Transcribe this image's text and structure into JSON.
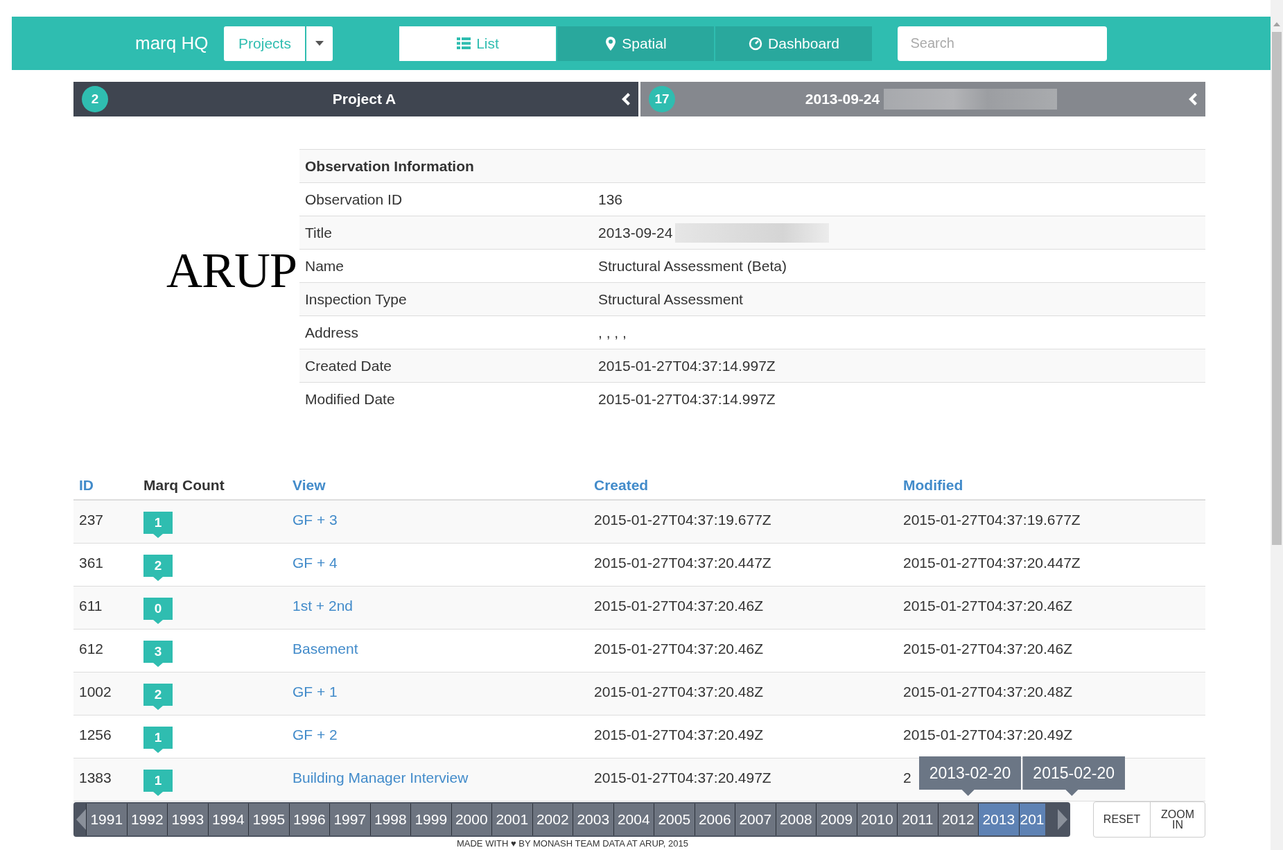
{
  "navbar": {
    "brand": "marq HQ",
    "projects_button": "Projects",
    "tabs": [
      {
        "label": "List",
        "selected": true
      },
      {
        "label": "Spatial",
        "selected": false
      },
      {
        "label": "Dashboard",
        "selected": false
      }
    ],
    "search": {
      "placeholder": "Search"
    }
  },
  "breadcrumb": [
    {
      "count": "2",
      "label": "Project A",
      "kind": "project"
    },
    {
      "count": "17",
      "label": "2013-09-24",
      "kind": "observation"
    }
  ],
  "observation_info": {
    "title": "Observation Information",
    "rows": [
      {
        "label": "Observation ID",
        "value": "136"
      },
      {
        "label": "Title",
        "value": "2013-09-24",
        "redacted": true
      },
      {
        "label": "Name",
        "value": "Structural Assessment (Beta)"
      },
      {
        "label": "Inspection Type",
        "value": "Structural Assessment"
      },
      {
        "label": "Address",
        "value": ", , , ,"
      },
      {
        "label": "Created Date",
        "value": "2015-01-27T04:37:14.997Z"
      },
      {
        "label": "Modified Date",
        "value": "2015-01-27T04:37:14.997Z"
      }
    ]
  },
  "logo": "ARUP",
  "table": {
    "columns": [
      {
        "label": "ID",
        "sortable": true
      },
      {
        "label": "Marq Count",
        "sortable": false
      },
      {
        "label": "View",
        "sortable": true
      },
      {
        "label": "Created",
        "sortable": true
      },
      {
        "label": "Modified",
        "sortable": true
      }
    ],
    "rows": [
      {
        "id": "237",
        "count": "1",
        "view": "GF + 3",
        "created": "2015-01-27T04:37:19.677Z",
        "modified": "2015-01-27T04:37:19.677Z"
      },
      {
        "id": "361",
        "count": "2",
        "view": "GF + 4",
        "created": "2015-01-27T04:37:20.447Z",
        "modified": "2015-01-27T04:37:20.447Z"
      },
      {
        "id": "611",
        "count": "0",
        "view": "1st + 2nd",
        "created": "2015-01-27T04:37:20.46Z",
        "modified": "2015-01-27T04:37:20.46Z"
      },
      {
        "id": "612",
        "count": "3",
        "view": "Basement",
        "created": "2015-01-27T04:37:20.46Z",
        "modified": "2015-01-27T04:37:20.46Z"
      },
      {
        "id": "1002",
        "count": "2",
        "view": "GF + 1",
        "created": "2015-01-27T04:37:20.48Z",
        "modified": "2015-01-27T04:37:20.48Z"
      },
      {
        "id": "1256",
        "count": "1",
        "view": "GF + 2",
        "created": "2015-01-27T04:37:20.49Z",
        "modified": "2015-01-27T04:37:20.49Z"
      },
      {
        "id": "1383",
        "count": "1",
        "view": "Building Manager Interview",
        "created": "2015-01-27T04:37:20.497Z",
        "modified": "2"
      }
    ]
  },
  "timeline": {
    "tooltips": [
      "2013-02-20",
      "2015-02-20"
    ],
    "years": [
      {
        "label": "1991",
        "selected": false
      },
      {
        "label": "1992",
        "selected": false
      },
      {
        "label": "1993",
        "selected": false
      },
      {
        "label": "1994",
        "selected": false
      },
      {
        "label": "1995",
        "selected": false
      },
      {
        "label": "1996",
        "selected": false
      },
      {
        "label": "1997",
        "selected": false
      },
      {
        "label": "1998",
        "selected": false
      },
      {
        "label": "1999",
        "selected": false
      },
      {
        "label": "2000",
        "selected": false
      },
      {
        "label": "2001",
        "selected": false
      },
      {
        "label": "2002",
        "selected": false
      },
      {
        "label": "2003",
        "selected": false
      },
      {
        "label": "2004",
        "selected": false
      },
      {
        "label": "2005",
        "selected": false
      },
      {
        "label": "2006",
        "selected": false
      },
      {
        "label": "2007",
        "selected": false
      },
      {
        "label": "2008",
        "selected": false
      },
      {
        "label": "2009",
        "selected": false
      },
      {
        "label": "2010",
        "selected": false
      },
      {
        "label": "2011",
        "selected": false
      },
      {
        "label": "2012",
        "selected": false
      },
      {
        "label": "2013",
        "selected": true
      },
      {
        "label": "201",
        "selected": true
      }
    ],
    "reset": "RESET",
    "zoom": [
      "ZOOM",
      "IN"
    ]
  },
  "footer": "MADE WITH ♥ BY MONASH TEAM DATA AT ARUP, 2015"
}
